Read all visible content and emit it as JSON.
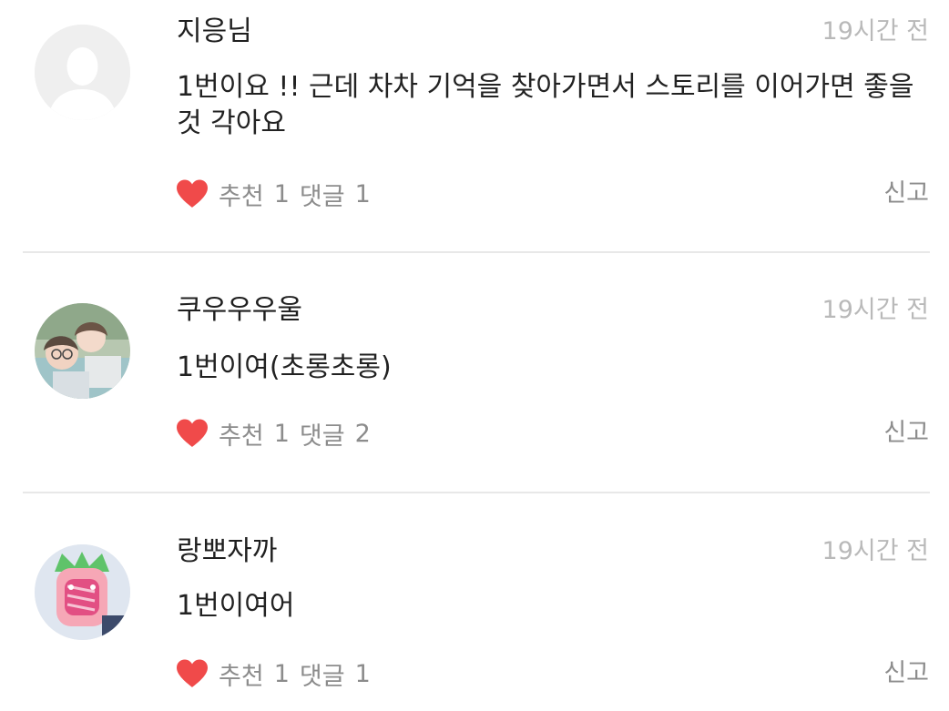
{
  "comments": [
    {
      "author": "지응님",
      "time": "19시간 전",
      "text": "1번이요 !! 근데 차차 기억을 찾아가면서 스토리를 이어가면 좋을것 각아요",
      "like_label": "추천",
      "like_count": "1",
      "reply_label": "댓글",
      "reply_count": "1",
      "report_label": "신고",
      "avatar": "default-user-icon"
    },
    {
      "author": "쿠우우우울",
      "time": "19시간 전",
      "text": "1번이여(초롱초롱)",
      "like_label": "추천",
      "like_count": "1",
      "reply_label": "댓글",
      "reply_count": "2",
      "report_label": "신고",
      "avatar": "photo-avatar"
    },
    {
      "author": "랑뽀자까",
      "time": "19시간 전",
      "text": "1번이여어",
      "like_label": "추천",
      "like_count": "1",
      "reply_label": "댓글",
      "reply_count": "1",
      "report_label": "신고",
      "avatar": "character-avatar"
    }
  ],
  "colors": {
    "heart": "#f04a4a",
    "meta_text": "#8c8c8c",
    "time_text": "#b9b9b9",
    "divider": "#e8e8e8"
  }
}
